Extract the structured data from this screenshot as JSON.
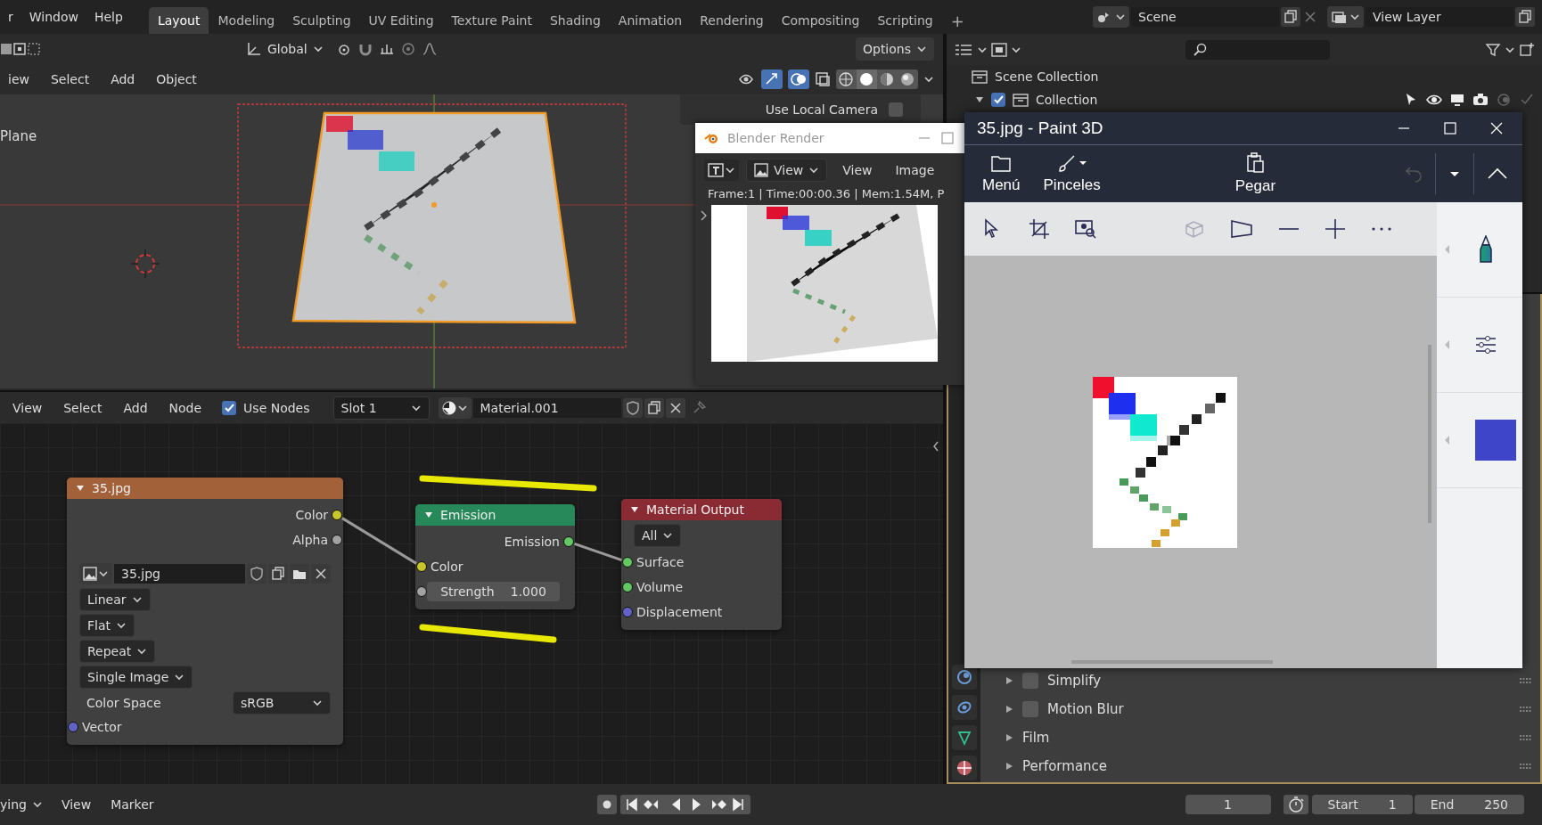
{
  "topbar": {
    "menus": [
      "r",
      "Window",
      "Help"
    ],
    "workspaces": [
      {
        "label": "Layout",
        "selected": true
      },
      {
        "label": "Modeling",
        "selected": false
      },
      {
        "label": "Sculpting",
        "selected": false
      },
      {
        "label": "UV Editing",
        "selected": false
      },
      {
        "label": "Texture Paint",
        "selected": false
      },
      {
        "label": "Shading",
        "selected": false
      },
      {
        "label": "Animation",
        "selected": false
      },
      {
        "label": "Rendering",
        "selected": false
      },
      {
        "label": "Compositing",
        "selected": false
      },
      {
        "label": "Scripting",
        "selected": false
      }
    ],
    "add_tab": "+",
    "scene": "Scene",
    "view_layer": "View Layer"
  },
  "viewport": {
    "orientation": "Global",
    "options": "Options",
    "menus": [
      "iew",
      "Select",
      "Add",
      "Object"
    ],
    "object_label": "Plane",
    "local_camera": {
      "label": "Use Local Camera",
      "checked": false
    }
  },
  "node_editor": {
    "menus": [
      "View",
      "Select",
      "Add",
      "Node"
    ],
    "use_nodes": {
      "label": "Use Nodes",
      "checked": true
    },
    "slot": "Slot 1",
    "material": "Material.001",
    "nodes": [
      {
        "kind": "image",
        "title": "35.jpg",
        "color": "#a3613a",
        "outputs": [
          {
            "label": "Color",
            "color": "#c7c729"
          },
          {
            "label": "Alpha",
            "color": "#a1a1a1"
          }
        ],
        "image_name": "35.jpg",
        "dropdowns": [
          "Linear",
          "Flat",
          "Repeat",
          "Single Image"
        ],
        "color_space": {
          "label": "Color Space",
          "value": "sRGB"
        },
        "inputs": [
          {
            "label": "Vector",
            "color": "#6363c7"
          }
        ]
      },
      {
        "kind": "emission",
        "title": "Emission",
        "color": "#27895a",
        "outputs": [
          {
            "label": "Emission",
            "color": "#63c763"
          }
        ],
        "inputs": [
          {
            "label": "Color",
            "color": "#c7c729"
          }
        ],
        "strength": {
          "label": "Strength",
          "value": "1.000",
          "color": "#a1a1a1"
        }
      },
      {
        "kind": "output",
        "title": "Material Output",
        "color": "#8a2a33",
        "target": "All",
        "inputs": [
          {
            "label": "Surface",
            "color": "#63c763"
          },
          {
            "label": "Volume",
            "color": "#63c763"
          },
          {
            "label": "Displacement",
            "color": "#6363c7"
          }
        ]
      }
    ]
  },
  "outliner": {
    "scene_collection": "Scene Collection",
    "collection": {
      "label": "Collection",
      "checked": true
    }
  },
  "properties": {
    "sections": [
      {
        "kind": "toggle",
        "label": "Simplify",
        "checked": false
      },
      {
        "kind": "toggle",
        "label": "Motion Blur",
        "checked": false
      },
      {
        "kind": "plain",
        "label": "Film"
      },
      {
        "kind": "plain",
        "label": "Performance"
      }
    ]
  },
  "timeline": {
    "mode": "ying",
    "menus": [
      "View",
      "Marker"
    ],
    "current_frame": "1",
    "start": {
      "label": "Start",
      "value": "1"
    },
    "end": {
      "label": "End",
      "value": "250"
    }
  },
  "render_window": {
    "title": "Blender Render",
    "view_dropdown": "View",
    "menus": [
      "View",
      "Image"
    ],
    "info": "Frame:1 | Time:00:00.36 | Mem:1.54M, P"
  },
  "paint3d": {
    "title": "35.jpg - Paint 3D",
    "ribbon": [
      {
        "kind": "menu",
        "label": "Menú"
      },
      {
        "kind": "brushes",
        "label": "Pinceles"
      },
      {
        "kind": "paste",
        "label": "Pegar"
      }
    ]
  }
}
